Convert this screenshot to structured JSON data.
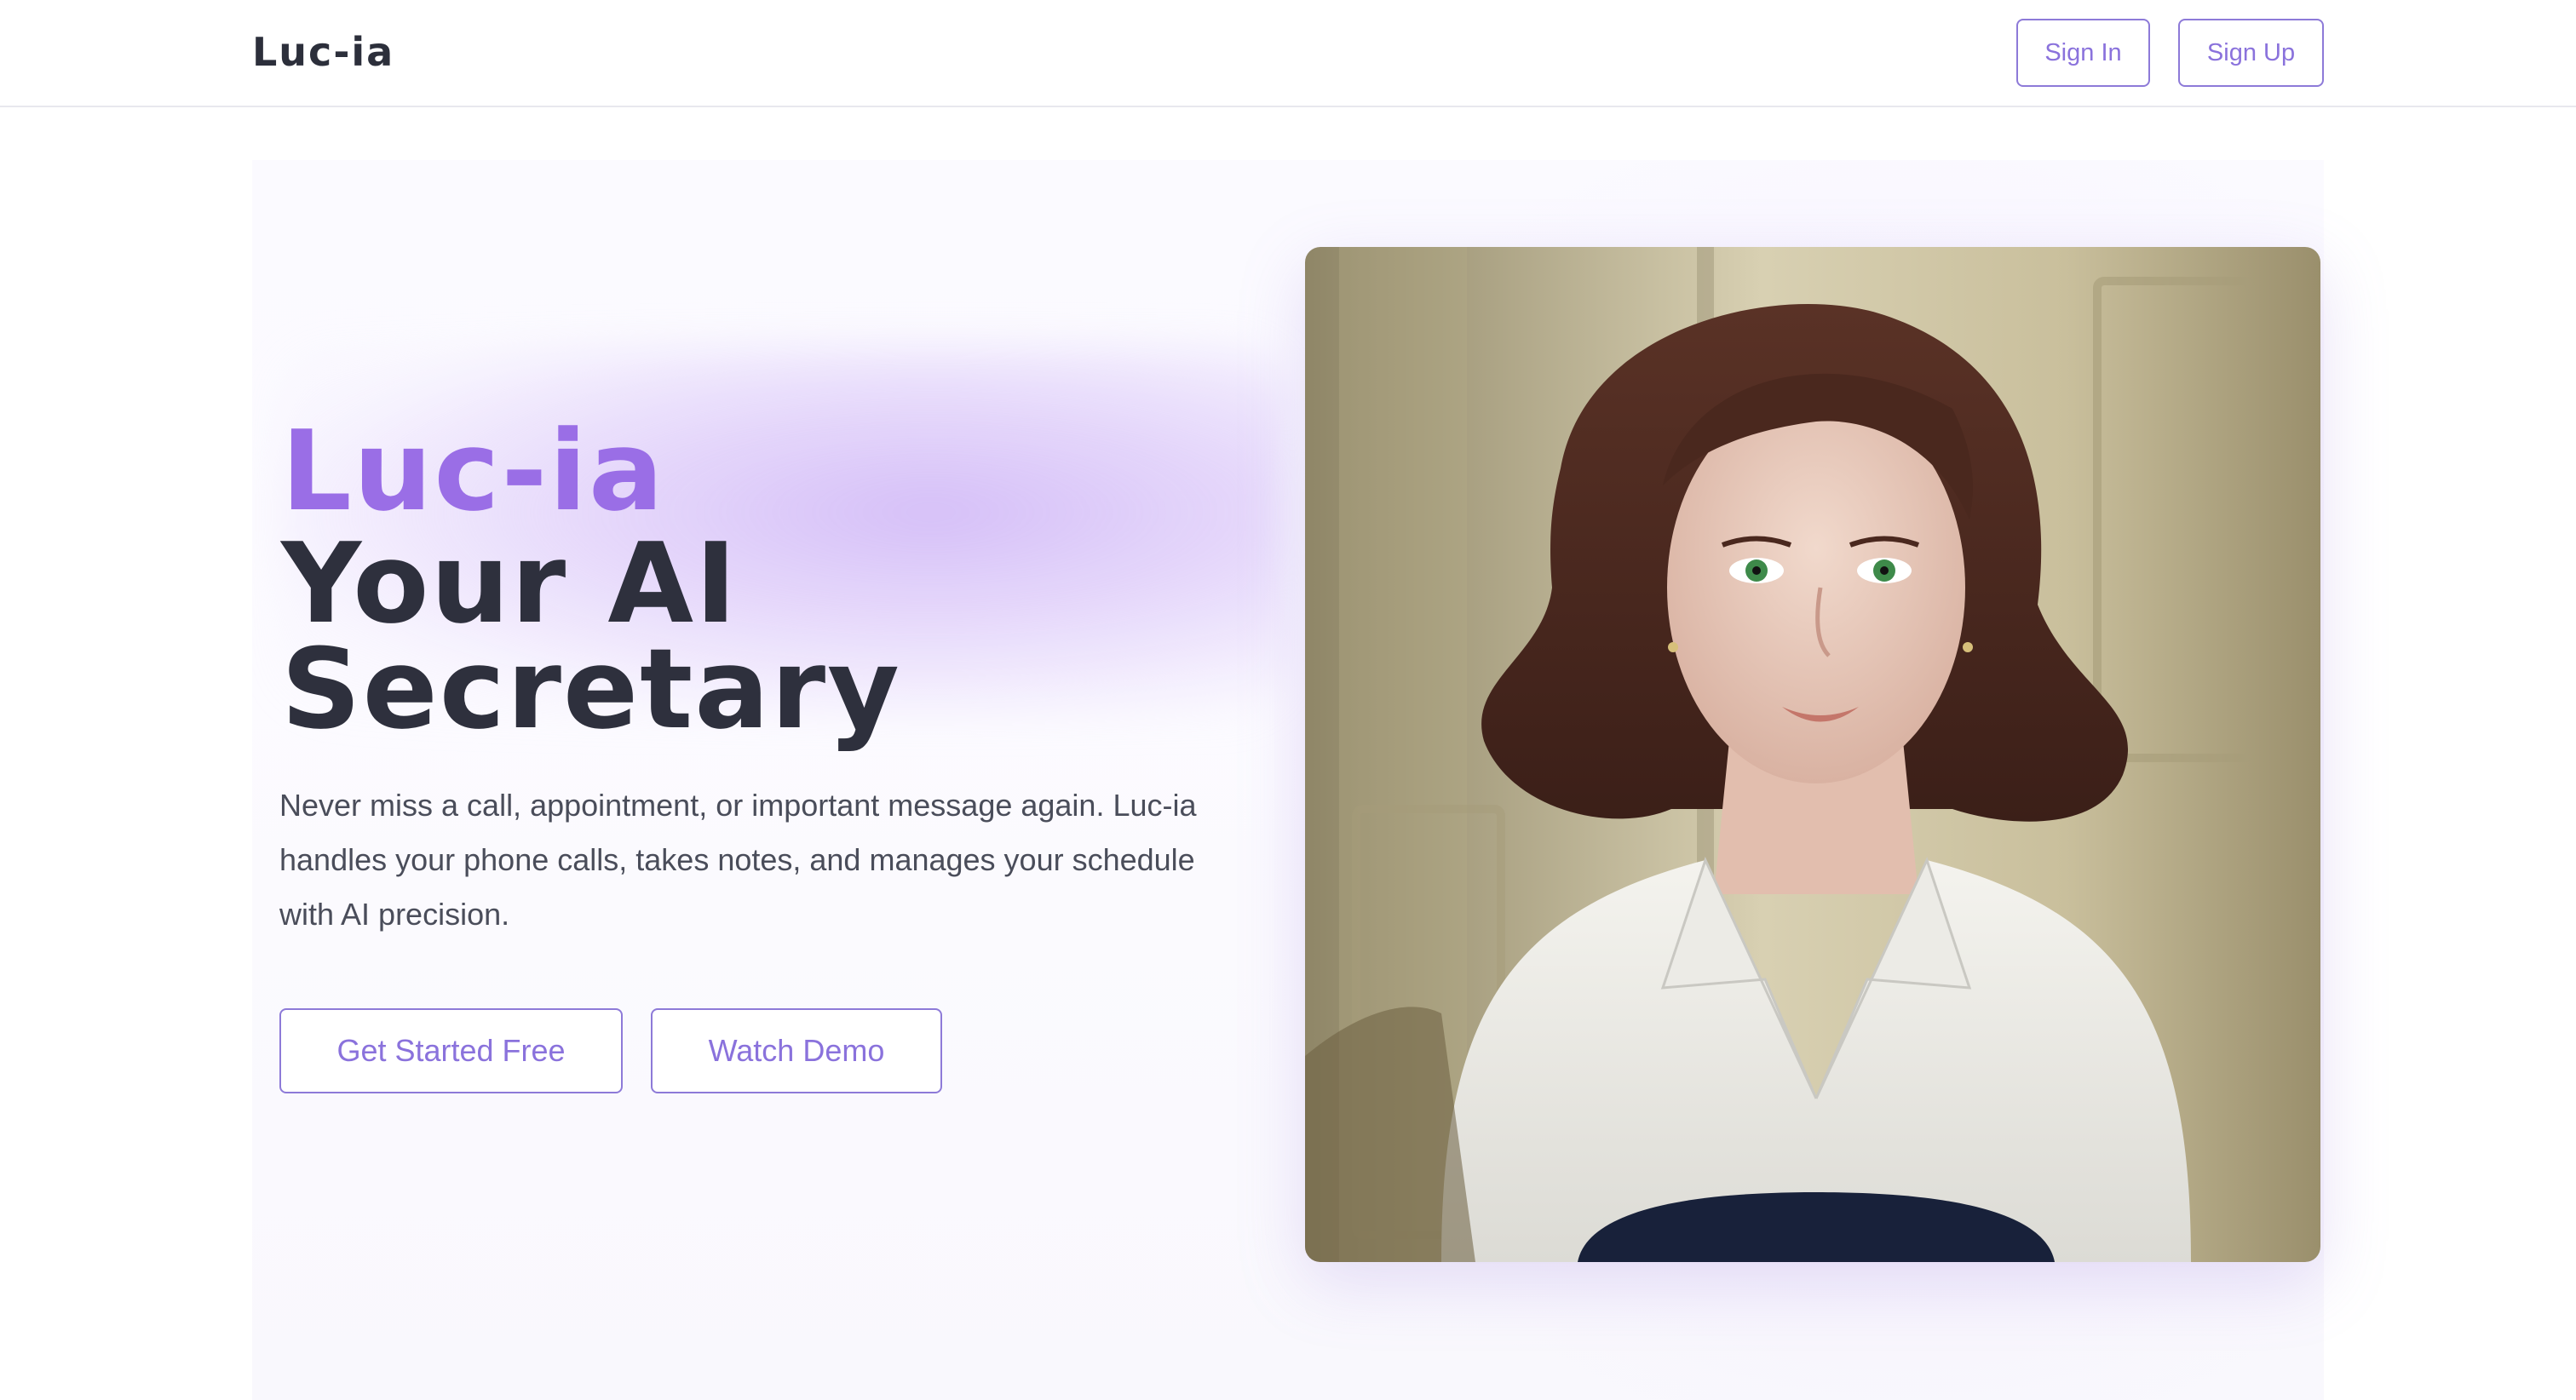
{
  "header": {
    "brand": "Luc-ia",
    "sign_in_label": "Sign In",
    "sign_up_label": "Sign Up"
  },
  "hero": {
    "title_brand": "Luc-ia",
    "title_line_1": "Your AI",
    "title_line_2": "Secretary",
    "description": "Never miss a call, appointment, or important message again. Luc-ia handles your phone calls, takes notes, and manages your schedule with AI precision.",
    "cta_primary_label": "Get Started Free",
    "cta_secondary_label": "Watch Demo"
  },
  "colors": {
    "accent": "#8a72dc",
    "brand_title": "#9a6ee6",
    "heading": "#2e303d",
    "body_text": "#4a4d5a"
  },
  "images": {
    "hero_portrait": "ai-secretary-portrait"
  }
}
